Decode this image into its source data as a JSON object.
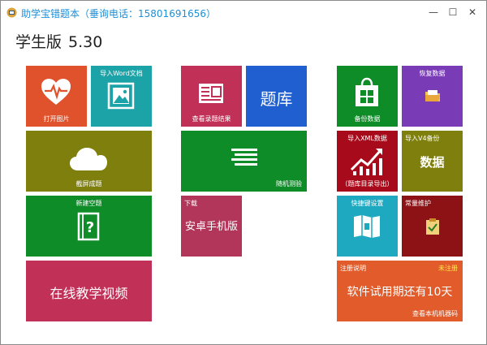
{
  "window": {
    "title": "助学宝错题本",
    "phone": "（垂询电话：15801691656）",
    "minimize": "—",
    "maximize": "☐",
    "close": "✕"
  },
  "header": {
    "edition": "学生版",
    "version": "5.30"
  },
  "tiles": {
    "open_picture": "打开图片",
    "import_word": "导入Word文档",
    "screenshot": "截屏成题",
    "new_blank": "新建空题",
    "online_video": "在线教学视频",
    "view_recorded": "查看录题结果",
    "question_bank": "题库",
    "random_test": "随机测验",
    "android_download": "下载",
    "android_title": "安卓手机版",
    "backup": "备份数据",
    "restore": "恢复数据",
    "import_xml": "导入XML数据",
    "export_catalog": "（题库目录导出）",
    "import_v4": "导入V4备份",
    "data": "数据",
    "shortcuts": "快捷键设置",
    "maintenance": "常量维护",
    "register_help": "注册说明",
    "not_registered": "未注册",
    "trial_days": "软件试用期还有10天",
    "machine_code": "查看本机机器码"
  },
  "colors": {
    "orange_red": "#e0522b",
    "teal": "#1ca3a8",
    "olive": "#7f7f0e",
    "green": "#0e8c28",
    "crimson": "#c13157",
    "blue": "#1f5fd0",
    "rose": "#b2365a",
    "purple": "#7a3bb6",
    "dark_red": "#a70a1a",
    "cyan": "#1fa9c1",
    "maroon": "#8d1216",
    "orange": "#e25b2a",
    "title_blue": "#1e8fd6",
    "not_registered": "#ffe94a"
  },
  "icons": [
    "heart-pulse-icon",
    "picture-icon",
    "cloud-icon",
    "question-book-icon",
    "newspaper-icon",
    "text-lines-icon",
    "store-bag-icon",
    "folder-restore-icon",
    "chart-up-icon",
    "map-icon",
    "clipboard-check-icon",
    "window-app-icon"
  ]
}
